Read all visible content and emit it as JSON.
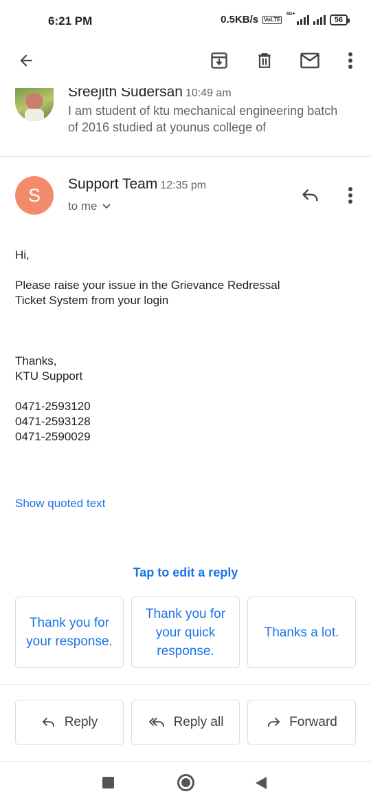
{
  "status_bar": {
    "time": "6:21 PM",
    "speed": "0.5KB/s",
    "volte": "Vo LTE",
    "network": "4G+",
    "battery": "56"
  },
  "toolbar": {
    "back_icon": "arrow-left-icon",
    "archive_icon": "archive-icon",
    "delete_icon": "trash-icon",
    "mark_unread_icon": "mail-icon",
    "more_icon": "more-vert-icon"
  },
  "previous_message": {
    "sender": "Sreejith Sudersan",
    "time": "10:49 am",
    "snippet": "I am student of ktu mechanical engineering batch of 2016 studied at younus college of"
  },
  "message": {
    "avatar_letter": "S",
    "avatar_color": "#f28b6c",
    "sender": "Support Team",
    "time": "12:35 pm",
    "recipient": "to me",
    "greeting": "Hi,",
    "paragraph": "Please raise your issue in the Grievance Redressal\nTicket System from your login",
    "signoff": "Thanks,\nKTU Support",
    "phones": "0471-2593120\n0471-2593128\n0471-2590029",
    "show_quoted": "Show quoted text"
  },
  "smart_reply": {
    "title": "Tap to edit a reply",
    "chips": [
      "Thank you for your response.",
      "Thank you for your quick response.",
      "Thanks a lot."
    ]
  },
  "actions": {
    "reply": "Reply",
    "reply_all": "Reply all",
    "forward": "Forward"
  },
  "colors": {
    "accent": "#1a73e8"
  }
}
